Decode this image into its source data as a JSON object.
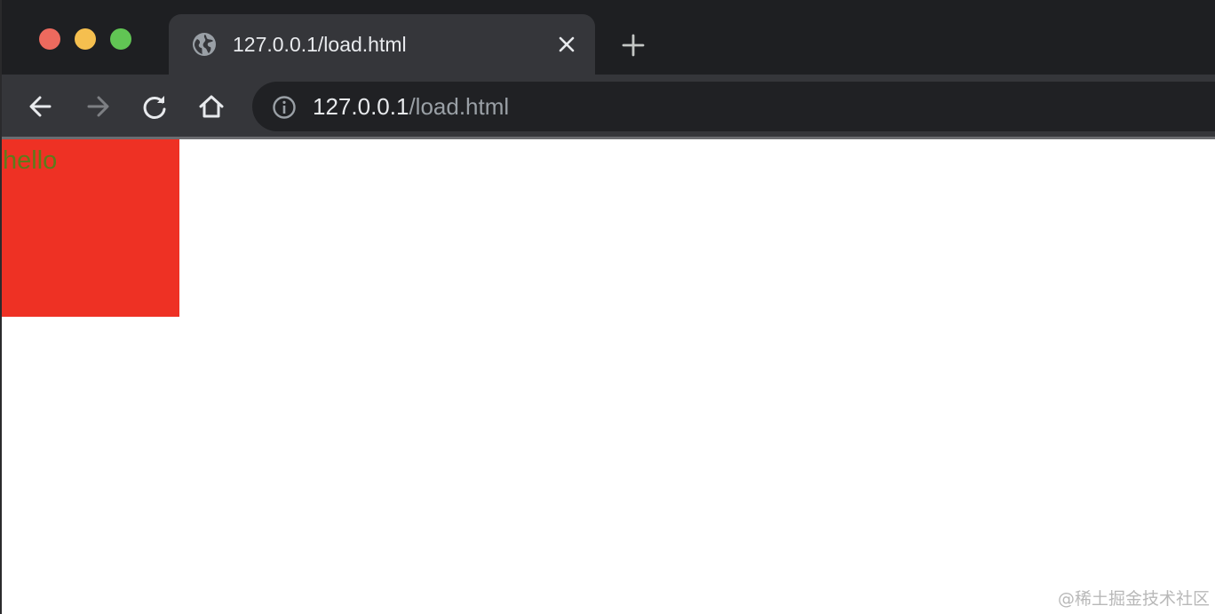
{
  "window": {
    "controls": [
      "close",
      "minimize",
      "maximize"
    ]
  },
  "tab": {
    "title": "127.0.0.1/load.html",
    "favicon": "globe-icon",
    "close_icon": "close-icon"
  },
  "toolbar": {
    "new_tab_icon": "plus-icon",
    "back_icon": "arrow-left-icon",
    "forward_icon": "arrow-right-icon",
    "reload_icon": "reload-icon",
    "home_icon": "home-icon",
    "forward_enabled": false
  },
  "omnibox": {
    "info_icon": "info-icon",
    "url_host": "127.0.0.1",
    "url_path": "/load.html"
  },
  "page": {
    "box_color": "#ee3124",
    "text": "hello",
    "text_color": "#5e7a1b"
  },
  "watermark": "@稀土掘金技术社区",
  "colors": {
    "titlebar": "#1e1f22",
    "tab_active": "#35363a",
    "omnibox": "#202124",
    "traffic_close": "#ed6a5e",
    "traffic_min": "#f5bf4f",
    "traffic_max": "#61c554"
  }
}
